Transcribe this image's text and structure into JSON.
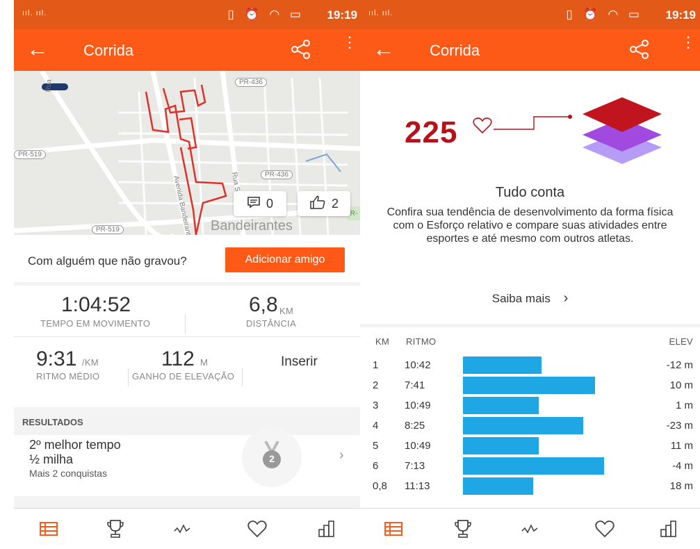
{
  "left": {
    "status_bar": {
      "signal": "ııl. ııl.",
      "time": "19:19"
    },
    "app_bar": {
      "title": "Corrida"
    },
    "map": {
      "road_labels": [
        "PR-436",
        "PR-519",
        "PR-436",
        "PR-519",
        "BR-",
        "Rua São P",
        "Avenida Bandeirantes",
        "Rua"
      ],
      "town": "Bandeirantes",
      "comment_count": "0",
      "kudos_count": "2"
    },
    "friend_prompt": {
      "text": "Com alguém que não gravou?",
      "button": "Adicionar amigo"
    },
    "stats": {
      "moving_time": {
        "value": "1:04:52",
        "label": "TEMPO EM MOVIMENTO"
      },
      "distance": {
        "value": "6,8",
        "unit": "KM",
        "label": "DISTÂNCIA"
      },
      "avg_pace": {
        "value": "9:31",
        "unit": "/KM",
        "label": "RITMO MÉDIO"
      },
      "elevation_gain": {
        "value": "112",
        "unit": "M",
        "label": "GANHO DE ELEVAÇÃO"
      },
      "insert": "Inserir"
    },
    "results": {
      "header": "RESULTADOS",
      "line1": "2º melhor tempo",
      "line2": "½ milha",
      "line3": "Mais 2 conquistas",
      "medal_number": "2"
    }
  },
  "right": {
    "status_bar": {
      "signal": "ııl. ııl.",
      "time": "19:19"
    },
    "app_bar": {
      "title": "Corrida"
    },
    "relative_effort": {
      "value": "225",
      "heading": "Tudo conta",
      "body": "Confira sua tendência de desenvolvimento da forma física com o Esforço relativo e compare suas atividades entre esportes e até mesmo com outros atletas.",
      "link": "Saiba mais"
    },
    "splits": {
      "headers": {
        "km": "KM",
        "pace": "RITMO",
        "elev": "ELEV"
      },
      "rows": [
        {
          "km": "1",
          "pace": "10:42",
          "elev": "-12 m",
          "bar": 0.53
        },
        {
          "km": "2",
          "pace": "7:41",
          "elev": "10 m",
          "bar": 0.89
        },
        {
          "km": "3",
          "pace": "10:49",
          "elev": "1 m",
          "bar": 0.51
        },
        {
          "km": "4",
          "pace": "8:25",
          "elev": "-23 m",
          "bar": 0.81
        },
        {
          "km": "5",
          "pace": "10:49",
          "elev": "11 m",
          "bar": 0.51
        },
        {
          "km": "6",
          "pace": "7:13",
          "elev": "-4 m",
          "bar": 0.95
        },
        {
          "km": "0,8",
          "pace": "11:13",
          "elev": "18 m",
          "bar": 0.47
        }
      ]
    }
  },
  "colors": {
    "accent": "#fc5a16",
    "status_bar": "#e35918",
    "route": "#e0302a",
    "effort": "#b5121b",
    "split_bar": "#1ea7e4"
  },
  "icons": [
    "back-arrow-icon",
    "share-icon",
    "more-vertical-icon",
    "comment-icon",
    "thumbs-up-icon",
    "medal-icon",
    "chevron-right-icon",
    "heart-icon",
    "feed-icon",
    "trophy-icon",
    "activity-icon",
    "stats-icon"
  ]
}
